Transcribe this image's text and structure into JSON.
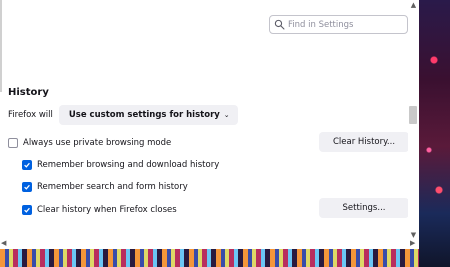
{
  "search": {
    "placeholder": "Find in Settings"
  },
  "history": {
    "title": "History",
    "firefox_will": "Firefox will",
    "mode_value": "Use custom settings for history",
    "clear_history_button": "Clear History...",
    "settings_button": "Settings...",
    "options": [
      {
        "label": "Always use private browsing mode",
        "checked": false
      },
      {
        "label": "Remember browsing and download history",
        "checked": true
      },
      {
        "label": "Remember search and form history",
        "checked": true
      },
      {
        "label": "Clear history when Firefox closes",
        "checked": true
      }
    ]
  },
  "colors": {
    "accent": "#0061e0",
    "button_bg": "#f0f0f4"
  },
  "icons": {
    "search": "search-icon",
    "checkmark": "checkmark-icon"
  }
}
